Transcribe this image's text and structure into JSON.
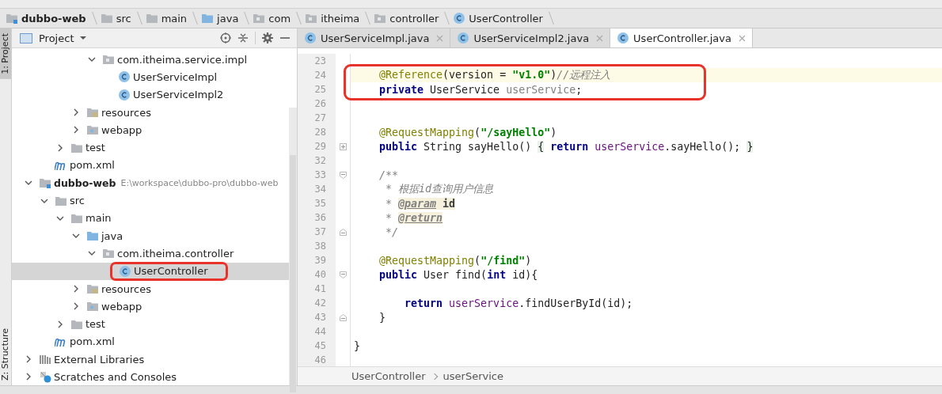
{
  "breadcrumb": [
    {
      "label": "dubbo-web",
      "kind": "module"
    },
    {
      "label": "src",
      "kind": "folder"
    },
    {
      "label": "main",
      "kind": "folder"
    },
    {
      "label": "java",
      "kind": "source"
    },
    {
      "label": "com",
      "kind": "package"
    },
    {
      "label": "itheima",
      "kind": "package"
    },
    {
      "label": "controller",
      "kind": "package"
    },
    {
      "label": "UserController",
      "kind": "class"
    }
  ],
  "tool_stripe": [
    {
      "label": "1: Project",
      "selected": true
    },
    {
      "label": "Z: Structure",
      "selected": false
    }
  ],
  "project_panel": {
    "title": "Project",
    "tree": [
      {
        "children": [
          {
            "children": [
              {
                "children": [
                  {
                    "children": [
                      {
                        "label": "com.itheima.service.impl",
                        "kind": "package",
                        "expanded": true,
                        "selected": false,
                        "children": [
                          {
                            "label": "UserServiceImpl",
                            "kind": "class",
                            "selected": false
                          },
                          {
                            "label": "UserServiceImpl2",
                            "kind": "class",
                            "selected": false
                          }
                        ]
                      }
                    ]
                  },
                  {
                    "label": "resources",
                    "kind": "resources",
                    "expanded": false,
                    "selected": false
                  },
                  {
                    "label": "webapp",
                    "kind": "webapp",
                    "expanded": false,
                    "selected": false
                  }
                ]
              },
              {
                "label": "test",
                "kind": "folder",
                "expanded": false,
                "selected": false
              }
            ]
          },
          {
            "label": "pom.xml",
            "kind": "maven",
            "selected": false
          }
        ]
      },
      {
        "label": "dubbo-web",
        "path": "E:\\workspace\\dubbo-pro\\dubbo-web",
        "kind": "module",
        "expanded": true,
        "selected": false,
        "children": [
          {
            "label": "src",
            "kind": "folder",
            "expanded": true,
            "selected": false,
            "children": [
              {
                "label": "main",
                "kind": "folder",
                "expanded": true,
                "selected": false,
                "children": [
                  {
                    "label": "java",
                    "kind": "source",
                    "expanded": true,
                    "selected": false,
                    "children": [
                      {
                        "label": "com.itheima.controller",
                        "kind": "package",
                        "expanded": true,
                        "selected": false,
                        "children": [
                          {
                            "label": "UserController",
                            "kind": "class",
                            "selected": true,
                            "circled": true
                          }
                        ]
                      }
                    ]
                  },
                  {
                    "label": "resources",
                    "kind": "resources",
                    "expanded": false,
                    "selected": false
                  },
                  {
                    "label": "webapp",
                    "kind": "webapp",
                    "expanded": false,
                    "selected": false
                  }
                ]
              },
              {
                "label": "test",
                "kind": "folder",
                "expanded": false,
                "selected": false
              }
            ]
          },
          {
            "label": "pom.xml",
            "kind": "maven",
            "selected": false
          }
        ]
      },
      {
        "label": "External Libraries",
        "kind": "libraries",
        "expanded": false,
        "selected": false
      },
      {
        "label": "Scratches and Consoles",
        "kind": "scratches",
        "expanded": false,
        "selected": false
      }
    ]
  },
  "editor": {
    "tabs": [
      {
        "label": "UserServiceImpl.java",
        "selected": false
      },
      {
        "label": "UserServiceImpl2.java",
        "selected": false
      },
      {
        "label": "UserController.java",
        "selected": true
      }
    ],
    "lines": [
      {
        "number": "23"
      },
      {
        "number": "24",
        "current": true,
        "circled": true,
        "tokens": [
          {
            "text": "    @Reference",
            "kind": "annotation"
          },
          {
            "text": "(version = "
          },
          {
            "text": "\"v1.0\"",
            "kind": "string"
          },
          {
            "text": ")"
          },
          {
            "text": "//远程注入",
            "kind": "comment"
          }
        ]
      },
      {
        "number": "25",
        "circled": true,
        "tokens": [
          {
            "text": "    private",
            "kind": "keyword"
          },
          {
            "text": " UserService "
          },
          {
            "text": "userService",
            "kind": "unused"
          },
          {
            "text": ";"
          }
        ]
      },
      {
        "number": "26"
      },
      {
        "number": "27"
      },
      {
        "number": "28",
        "tokens": [
          {
            "text": "    @RequestMapping",
            "kind": "annotation"
          },
          {
            "text": "("
          },
          {
            "text": "\"/sayHello\"",
            "kind": "string"
          },
          {
            "text": ")"
          }
        ]
      },
      {
        "number": "29",
        "collapsed": true,
        "tokens": [
          {
            "text": "    public",
            "kind": "keyword"
          },
          {
            "text": " String sayHello() "
          },
          {
            "text": "{",
            "kind": "folded"
          },
          {
            "text": " return",
            "kind": "keyword"
          },
          {
            "text": " userService",
            "kind": "field"
          },
          {
            "text": ".sayHello(); "
          },
          {
            "text": "}",
            "kind": "folded"
          }
        ]
      },
      {
        "number": "32"
      },
      {
        "number": "33",
        "fold_start": true,
        "tokens": [
          {
            "text": "    /**",
            "kind": "comment"
          }
        ]
      },
      {
        "number": "34",
        "tokens": [
          {
            "text": "     * 根据",
            "kind": "comment"
          },
          {
            "text": "id",
            "kind": "comment-italic"
          },
          {
            "text": "查询用户信息",
            "kind": "comment"
          }
        ]
      },
      {
        "number": "35",
        "tokens": [
          {
            "text": "     * ",
            "kind": "comment"
          },
          {
            "text": "@param",
            "kind": "doctag"
          },
          {
            "text": " id",
            "kind": "docparam"
          }
        ]
      },
      {
        "number": "36",
        "tokens": [
          {
            "text": "     * ",
            "kind": "comment"
          },
          {
            "text": "@return",
            "kind": "doctag"
          }
        ]
      },
      {
        "number": "37",
        "fold_end": true,
        "tokens": [
          {
            "text": "     */",
            "kind": "comment"
          }
        ]
      },
      {
        "number": "38"
      },
      {
        "number": "39",
        "tokens": [
          {
            "text": "    @RequestMapping",
            "kind": "annotation"
          },
          {
            "text": "("
          },
          {
            "text": "\"/find\"",
            "kind": "string"
          },
          {
            "text": ")"
          }
        ]
      },
      {
        "number": "40",
        "fold_start": true,
        "tokens": [
          {
            "text": "    public",
            "kind": "keyword"
          },
          {
            "text": " User find("
          },
          {
            "text": "int",
            "kind": "keyword"
          },
          {
            "text": " id){"
          }
        ]
      },
      {
        "number": "41"
      },
      {
        "number": "42",
        "tokens": [
          {
            "text": "        return",
            "kind": "keyword"
          },
          {
            "text": " userService",
            "kind": "field"
          },
          {
            "text": ".findUserById(id);"
          }
        ]
      },
      {
        "number": "43",
        "fold_end": true,
        "tokens": [
          {
            "text": "    }"
          }
        ]
      },
      {
        "number": "44"
      },
      {
        "number": "45",
        "tokens": [
          {
            "text": "}"
          }
        ]
      },
      {
        "number": "46"
      }
    ],
    "path": [
      "UserController",
      "userService"
    ]
  }
}
